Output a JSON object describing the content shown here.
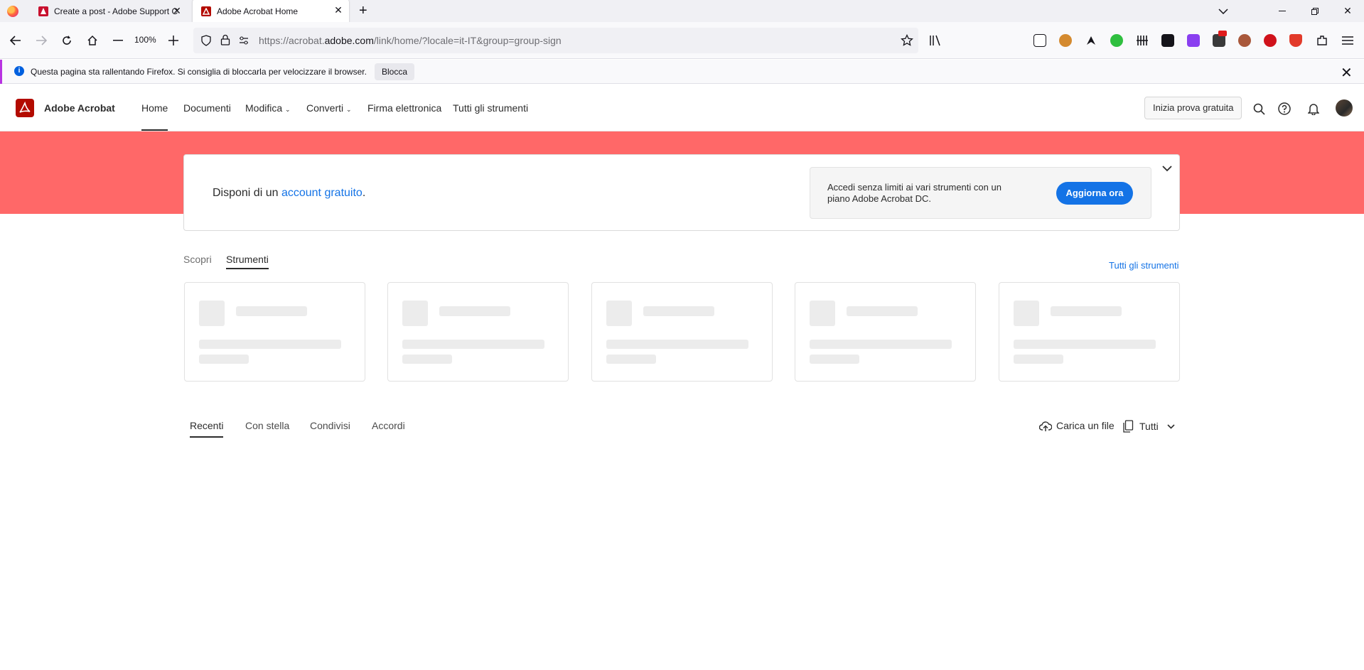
{
  "browser": {
    "tabs": [
      {
        "title": "Create a post - Adobe Support C",
        "favicon": "adobe-logo-icon",
        "active": false
      },
      {
        "title": "Adobe Acrobat Home",
        "favicon": "acrobat-logo-icon",
        "active": true
      }
    ],
    "zoom": "100%",
    "url_prefix": "https://acrobat.",
    "url_domain": "adobe.com",
    "url_path": "/link/home/?locale=it-IT&group=group-sign"
  },
  "notification": {
    "message": "Questa pagina sta rallentando Firefox. Si consiglia di bloccarla per velocizzare il browser.",
    "button": "Blocca"
  },
  "app": {
    "name": "Adobe Acrobat",
    "nav": [
      {
        "label": "Home",
        "active": true
      },
      {
        "label": "Documenti"
      },
      {
        "label": "Modifica",
        "dropdown": true
      },
      {
        "label": "Converti",
        "dropdown": true
      },
      {
        "label": "Firma elettronica"
      },
      {
        "label": "Tutti gli strumenti"
      }
    ],
    "trial_button": "Inizia prova gratuita",
    "brand_color": "#b30b00",
    "accent_color": "#1473e6",
    "banner_color": "#ff6868"
  },
  "promo": {
    "text_before": "Disponi di un ",
    "link": "account gratuito",
    "text_after": ".",
    "upgrade_text": "Accedi senza limiti ai vari strumenti con un piano Adobe Acrobat DC.",
    "upgrade_button": "Aggiorna ora"
  },
  "tools": {
    "tabs": [
      {
        "label": "Scopri"
      },
      {
        "label": "Strumenti",
        "active": true
      }
    ],
    "all_tools_link": "Tutti gli strumenti",
    "card_count_loading": 5
  },
  "recents": {
    "tabs": [
      {
        "label": "Recenti",
        "active": true
      },
      {
        "label": "Con stella"
      },
      {
        "label": "Condivisi"
      },
      {
        "label": "Accordi"
      }
    ],
    "upload_label": "Carica un file",
    "filter_label": "Tutti"
  }
}
